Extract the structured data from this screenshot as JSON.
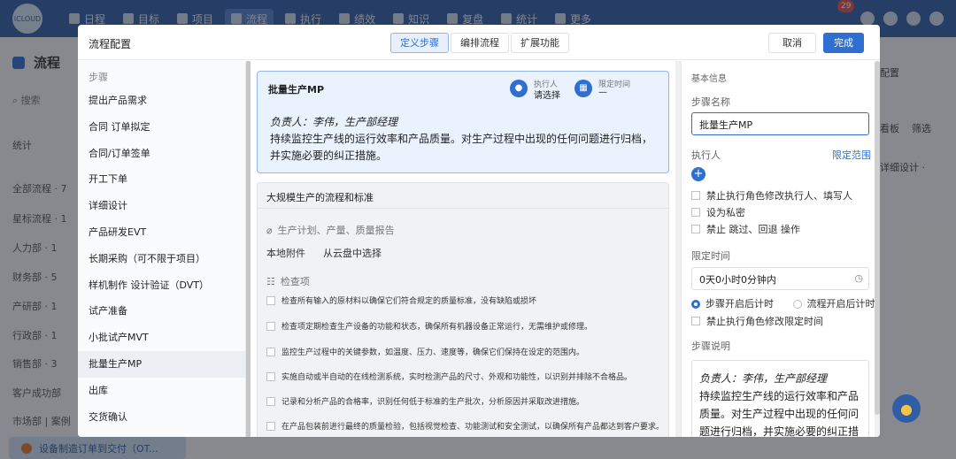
{
  "topnav": {
    "logo_text": "ICLOUD",
    "items": [
      "日程",
      "目标",
      "项目",
      "流程",
      "执行",
      "绩效",
      "知识",
      "复盘",
      "统计",
      "更多"
    ],
    "notification_count": "29"
  },
  "background": {
    "page_title": "流程",
    "search_placeholder": "搜索",
    "left_items": [
      "统计",
      "全部流程 · 7",
      "星标流程 · 1",
      "人力部 · 1",
      "财务部 · 5",
      "产研部 · 1",
      "行政部 · 1",
      "销售部 · 3",
      "客户成功部",
      "市场部 | 案例"
    ],
    "right_items": [
      "配置",
      "看板",
      "筛选",
      "详细设计 ·"
    ],
    "bottom_task": "设备制造订单到交付（OT..."
  },
  "modal": {
    "title": "流程配置",
    "tabs": [
      "定义步骤",
      "编排流程",
      "扩展功能"
    ],
    "cancel": "取消",
    "done": "完成",
    "steps_header": "步骤",
    "steps": [
      "提出产品需求",
      "合同 订单拟定",
      "合同/订单签单",
      "开工下单",
      "详细设计",
      "产品研发EVT",
      "长期采购（可不限于项目）",
      "样机制作 设计验证（DVT）",
      "试产准备",
      "小批试产MVT",
      "批量生产MP",
      "出库",
      "交货确认"
    ],
    "active_step_index": 10,
    "card": {
      "name": "批量生产MP",
      "executor_label": "执行人",
      "executor_value": "请选择",
      "deadline_label": "限定时间",
      "deadline_value": "—",
      "responsible": "负责人：李伟，生产部经理",
      "description": "持续监控生产线的运行效率和产品质量。对生产过程中出现的任何问题进行归档，并实施必要的纠正措施。"
    },
    "detail": {
      "title": "大规模生产的流程和标准",
      "attachment_title": "生产计划、产量、质量报告",
      "local_attach": "本地附件",
      "cloud_attach": "从云盘中选择",
      "checklist_title": "检查项",
      "checklist": [
        "检查所有输入的原材料以确保它们符合规定的质量标准，没有缺陷或损坏",
        "检查项定期检查生产设备的功能和状态，确保所有机器设备正常运行，无需维护或修理。",
        "监控生产过程中的关键参数，如温度、压力、速度等，确保它们保持在设定的范围内。",
        "实施自动或半自动的在线检测系统，实时检测产品的尺寸、外观和功能性，以识别并排除不合格品。",
        "记录和分析产品的合格率，识别任何低于标准的生产批次，分析原因并采取改进措施。",
        "在产品包装前进行最终的质量检验，包括视觉检查、功能测试和安全测试，以确保所有产品都达到客户要求。"
      ]
    },
    "info": {
      "section": "基本信息",
      "name_label": "步骤名称",
      "name_value": "批量生产MP",
      "executor_label": "执行人",
      "limit_scope": "限定范围",
      "options": [
        "禁止执行角色修改执行人、填写人",
        "设为私密",
        "禁止 跳过、回退 操作"
      ],
      "time_label": "限定时间",
      "time_value": "0天0小时0分钟内",
      "radio_1": "步骤开启后计时",
      "radio_2": "流程开启后计时",
      "time_option": "禁止执行角色修改限定时间",
      "desc_label": "步骤说明",
      "desc_responsible": "负责人：李伟，生产部经理",
      "desc_text": "持续监控生产线的运行效率和产品质量。对生产过程中出现的任何问题进行归档，并实施必要的纠正措"
    }
  }
}
